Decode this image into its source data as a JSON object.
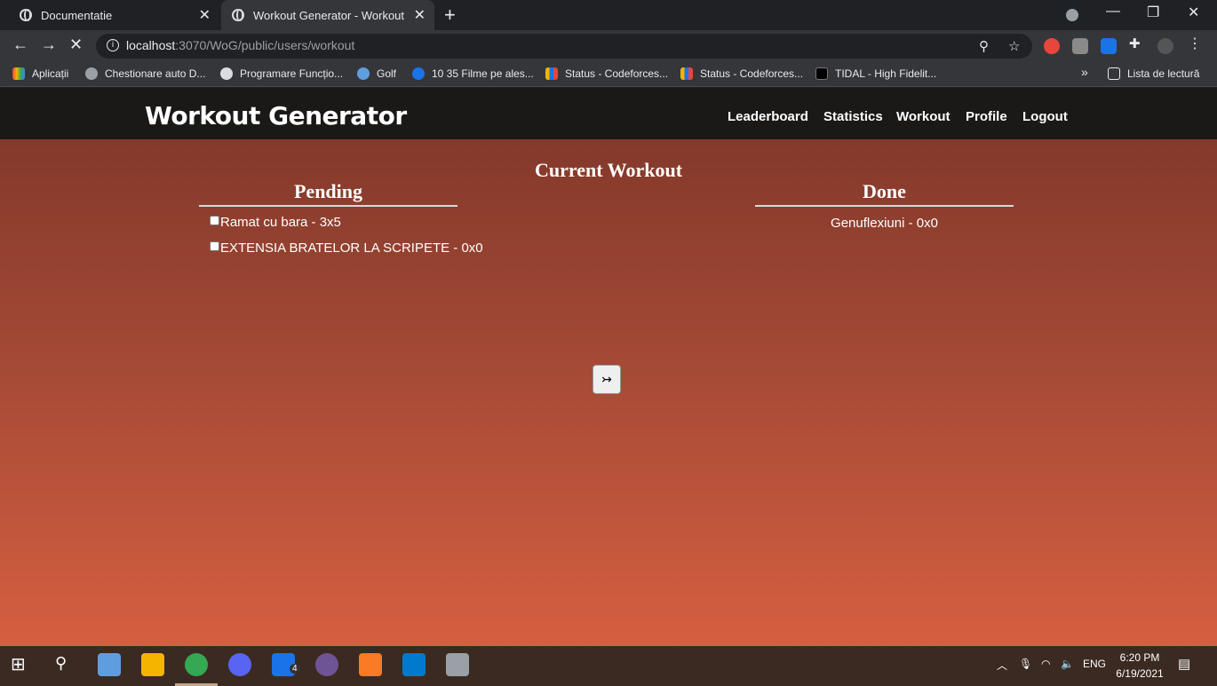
{
  "browser": {
    "tabs": [
      {
        "title": "Documentatie"
      },
      {
        "title": "Workout Generator - Workout"
      }
    ],
    "url": {
      "host": "localhost",
      "path": ":3070/WoG/public/users/workout"
    },
    "bookmarks": [
      {
        "label": "Aplicații",
        "color": "#e8453c"
      },
      {
        "label": "Chestionare auto D...",
        "color": "#9aa0a6"
      },
      {
        "label": "Programare Funcțio...",
        "color": "#dadce0"
      },
      {
        "label": "Golf",
        "color": "#5f9ede"
      },
      {
        "label": "10 35 Filme pe ales...",
        "color": "#1a73e8"
      },
      {
        "label": "Status - Codeforces...",
        "color": "#f4b400"
      },
      {
        "label": "Status - Codeforces...",
        "color": "#1a73e8"
      },
      {
        "label": "TIDAL - High Fidelit...",
        "color": "#000000"
      }
    ],
    "reading_list": "Lista de lectură"
  },
  "site": {
    "logo": "Workout Generator",
    "nav": [
      "Leaderboard",
      "Statistics",
      "Workout",
      "Profile",
      "Logout"
    ]
  },
  "workout": {
    "title": "Current Workout",
    "pending_title": "Pending",
    "done_title": "Done",
    "pending": [
      "Ramat cu bara - 3x5",
      "EXTENSIA BRATELOR LA SCRIPETE - 0x0"
    ],
    "done": [
      "Genuflexiuni - 0x0"
    ],
    "next_button": "↣"
  },
  "taskbar": {
    "language": "ENG",
    "time": "6:20 PM",
    "date": "6/19/2021",
    "mail_badge": "4"
  }
}
